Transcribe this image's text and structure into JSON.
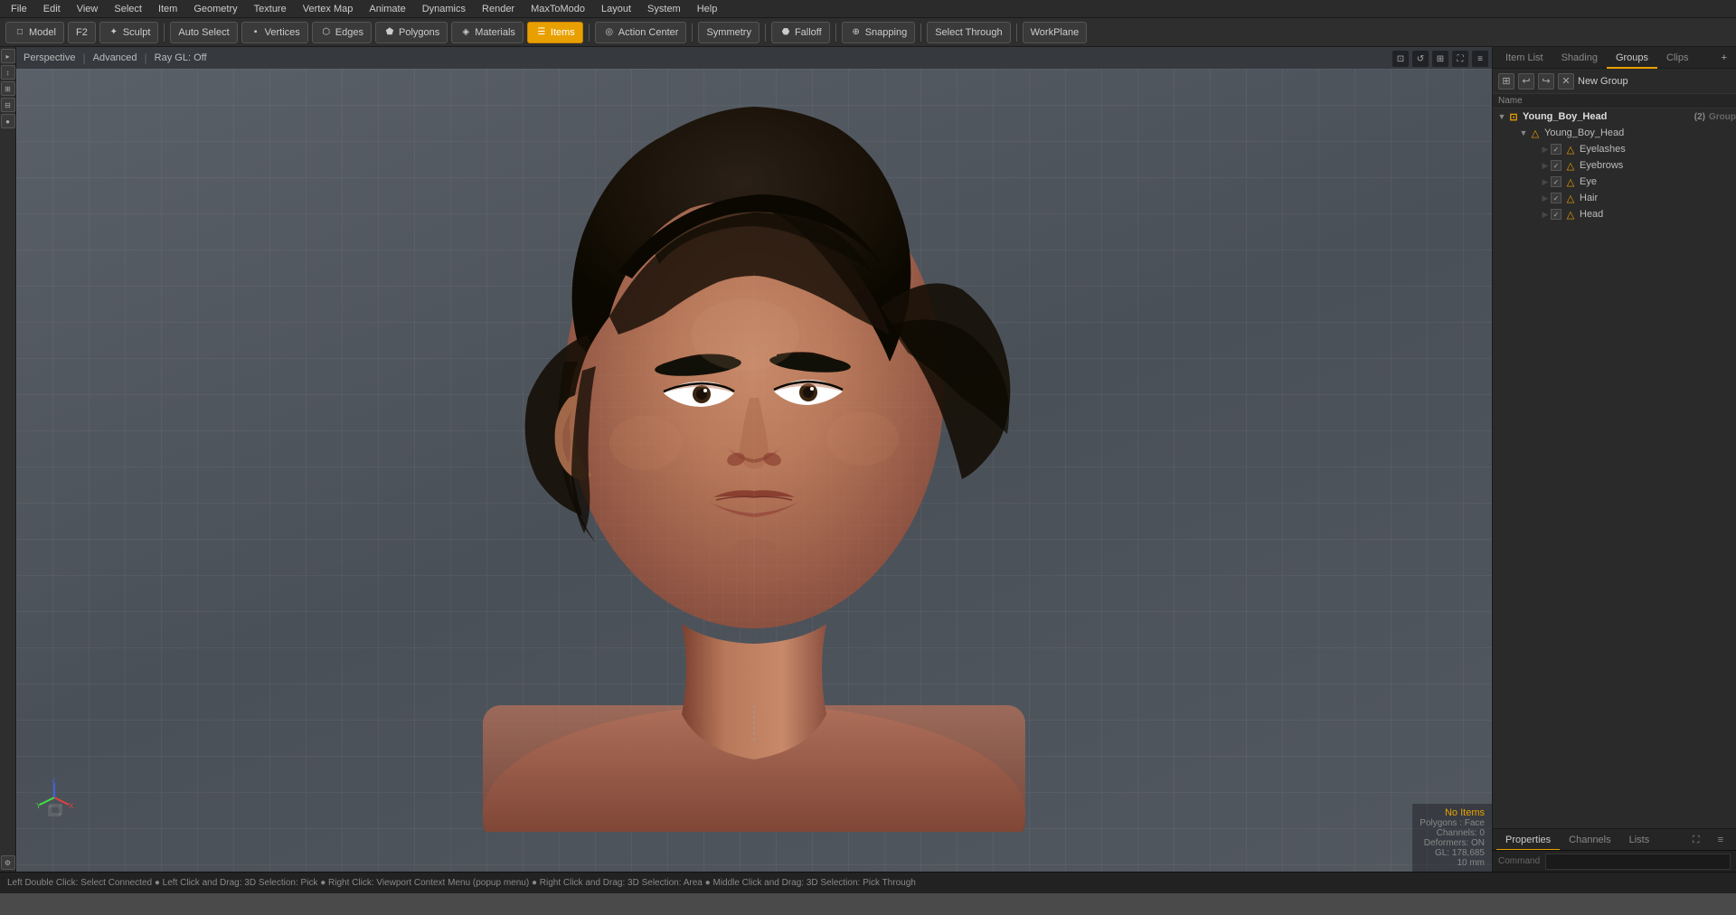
{
  "menubar": {
    "items": [
      "File",
      "Edit",
      "View",
      "Select",
      "Item",
      "Geometry",
      "Texture",
      "Vertex Map",
      "Animate",
      "Dynamics",
      "Render",
      "MaxToModo",
      "Layout",
      "System",
      "Help"
    ]
  },
  "toolbar": {
    "mode_model": "Model",
    "mode_f2": "F2",
    "mode_sculpt": "Sculpt",
    "btn_auto_select": "Auto Select",
    "btn_vertices": "Vertices",
    "btn_edges": "Edges",
    "btn_polygons": "Polygons",
    "btn_materials": "Materials",
    "btn_items": "Items",
    "btn_action_center": "Action Center",
    "btn_symmetry": "Symmetry",
    "btn_falloff": "Falloff",
    "btn_snapping": "Snapping",
    "btn_select_through": "Select Through",
    "btn_workplane": "WorkPlane"
  },
  "viewport": {
    "label_perspective": "Perspective",
    "label_advanced": "Advanced",
    "label_raygl": "Ray GL: Off"
  },
  "viewport_info": {
    "no_items": "No Items",
    "polygons": "Polygons : Face",
    "channels": "Channels: 0",
    "deformers": "Deformers: ON",
    "gl": "GL: 178,685",
    "size": "10 mm"
  },
  "right_panel": {
    "tabs": [
      "Item List",
      "Shading",
      "Groups",
      "Clips"
    ],
    "active_tab": "Groups",
    "tab_add": "+",
    "new_group_label": "New Group",
    "name_header": "Name",
    "tree": {
      "root": {
        "label": "Young_Boy_Head",
        "count": "(2)",
        "type": "Group",
        "expanded": true,
        "children": [
          {
            "label": "Young_Boy_Head",
            "type": "",
            "expanded": true,
            "children": [
              {
                "label": "Eyelashes",
                "checked": true
              },
              {
                "label": "Eyebrows",
                "checked": true
              },
              {
                "label": "Eye",
                "checked": true
              },
              {
                "label": "Hair",
                "checked": true
              },
              {
                "label": "Head",
                "checked": true
              }
            ]
          }
        ]
      }
    }
  },
  "bottom_panel": {
    "tabs": [
      "Properties",
      "Channels",
      "Lists"
    ],
    "active_tab": "Properties"
  },
  "statusbar": {
    "text": "Left Double Click: Select Connected  ● Left Click and Drag: 3D Selection: Pick  ● Right Click: Viewport Context Menu (popup menu)  ● Right Click and Drag: 3D Selection: Area  ● Middle Click and Drag: 3D Selection: Pick Through"
  },
  "command": {
    "label": "Command",
    "placeholder": ""
  },
  "icons": {
    "vertices": "▪",
    "edges": "⬡",
    "polygons": "⬟",
    "materials": "◈",
    "items": "☰",
    "action_center": "◎",
    "symmetry": "⇌",
    "falloff": "⬣",
    "snapping": "⊕",
    "model": "□",
    "sculpt": "✦",
    "gear": "⚙",
    "eye": "👁",
    "expand": "▶",
    "collapse": "▼",
    "checkbox_checked": "✓",
    "lock": "🔒",
    "camera": "📷",
    "render": "▷",
    "zoom_in": "+",
    "zoom_out": "-",
    "fullscreen": "⛶",
    "settings": "≡"
  }
}
